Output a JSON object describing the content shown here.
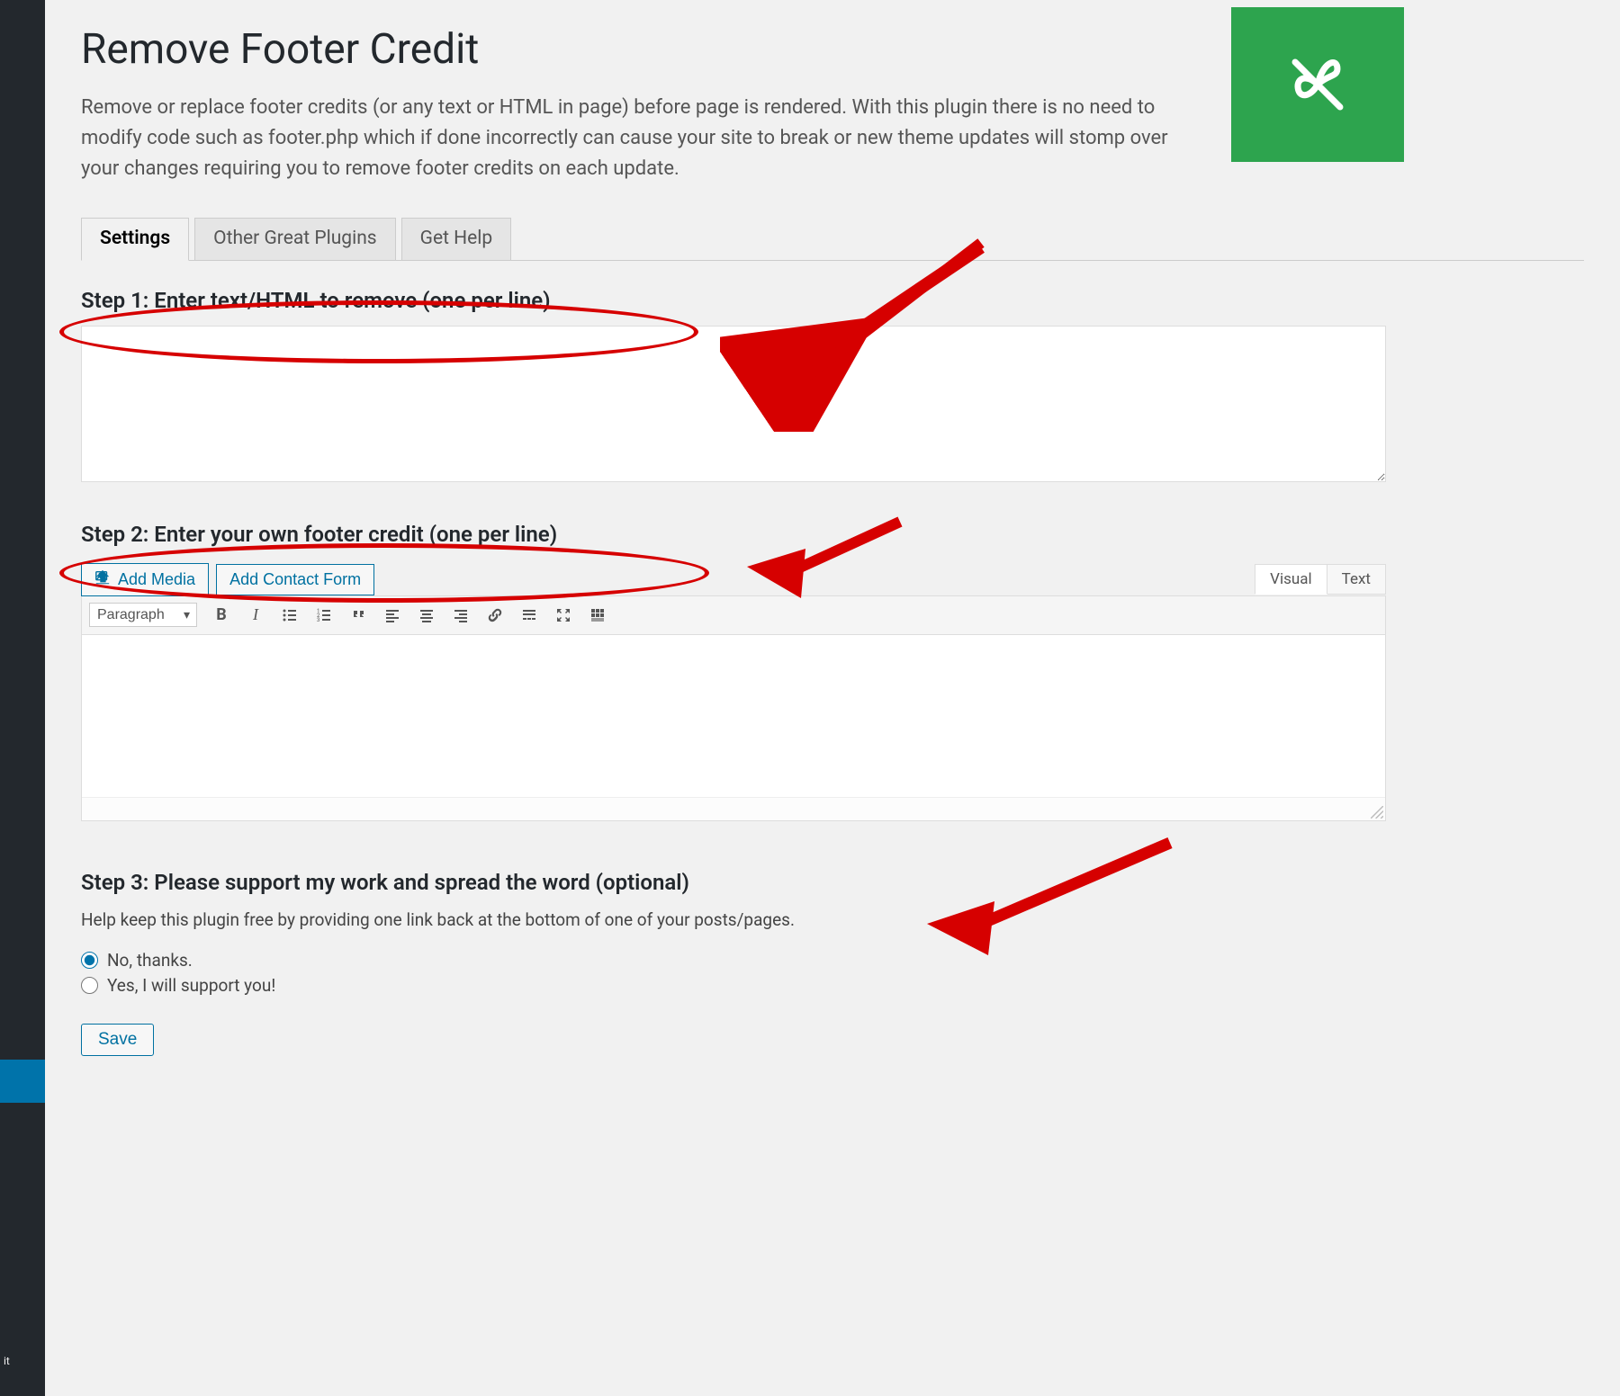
{
  "sidebar": {
    "truncated_label": "it"
  },
  "header": {
    "title": "Remove Footer Credit",
    "intro": "Remove or replace footer credits (or any text or HTML in page) before page is rendered. With this plugin there is no need to modify code such as footer.php which if done incorrectly can cause your site to break or new theme updates will stomp over your changes requiring you to remove footer credits on each update."
  },
  "tabs": {
    "settings": "Settings",
    "other": "Other Great Plugins",
    "help": "Get Help"
  },
  "steps": {
    "s1": "Step 1: Enter text/HTML to remove (one per line)",
    "s2": "Step 2: Enter your own footer credit (one per line)",
    "s3": "Step 3: Please support my work and spread the word (optional)"
  },
  "media": {
    "add_media": "Add Media",
    "add_contact_form": "Add Contact Form"
  },
  "editor": {
    "visual": "Visual",
    "text": "Text",
    "paragraph": "Paragraph"
  },
  "support": {
    "text": "Help keep this plugin free by providing one link back at the bottom of one of your posts/pages.",
    "no": "No, thanks.",
    "yes": "Yes, I will support you!"
  },
  "buttons": {
    "save": "Save"
  }
}
